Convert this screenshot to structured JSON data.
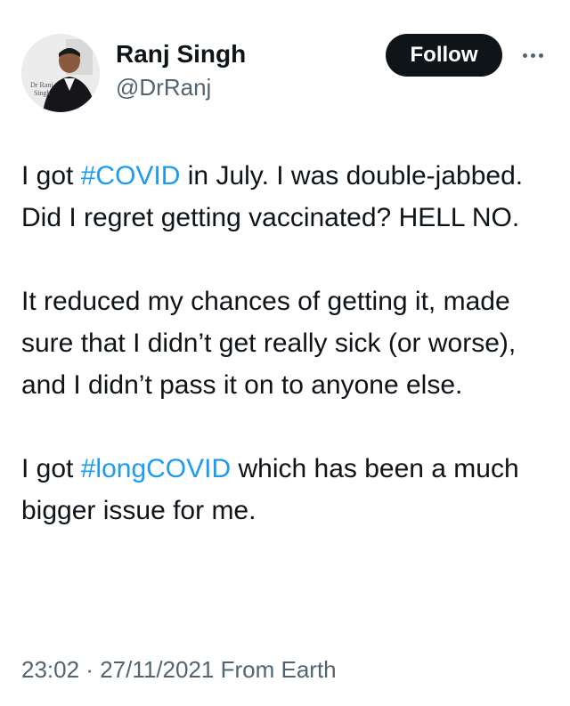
{
  "author": {
    "display_name": "Ranj Singh",
    "handle": "@DrRanj",
    "avatar_caption_line1": "Dr Ranj",
    "avatar_caption_line2": "Singh"
  },
  "actions": {
    "follow_label": "Follow",
    "more_icon": "more-horizontal-icon"
  },
  "tweet": {
    "p1": {
      "t1": "I got ",
      "hashtag": "#COVID",
      "t2": " in July. I was double-jabbed. Did I regret getting vaccinated? HELL NO."
    },
    "p2": "It reduced my chances of getting it, made sure that I didn’t get really sick (or worse), and I didn’t pass it on to anyone else.",
    "p3": {
      "t1": "I got ",
      "hashtag": "#longCOVID",
      "t2": " which has been a much bigger issue for me."
    }
  },
  "meta": {
    "time": "23:02",
    "separator": " · ",
    "date": "27/11/2021",
    "source": " From Earth"
  },
  "colors": {
    "link": "#1d9bf0",
    "text": "#0f1419",
    "secondary": "#536471",
    "button_bg": "#0f1419"
  }
}
